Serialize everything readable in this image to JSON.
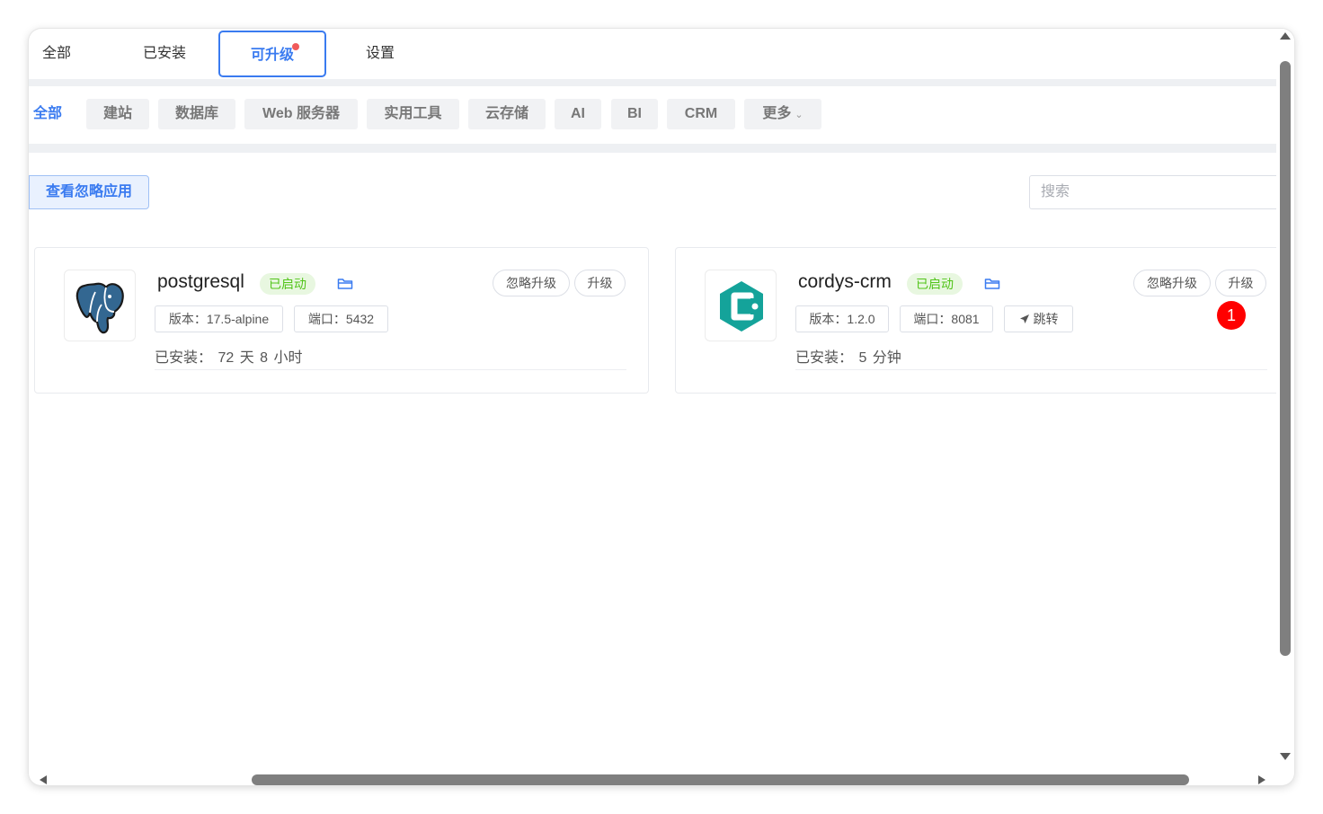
{
  "tabs": [
    {
      "label": "全部"
    },
    {
      "label": "已安装"
    },
    {
      "label": "可升级",
      "active": true,
      "has_dot": true
    },
    {
      "label": "设置"
    }
  ],
  "categories": [
    {
      "label": "全部",
      "active": true
    },
    {
      "label": "建站"
    },
    {
      "label": "数据库"
    },
    {
      "label": "Web 服务器"
    },
    {
      "label": "实用工具"
    },
    {
      "label": "云存储"
    },
    {
      "label": "AI"
    },
    {
      "label": "BI"
    },
    {
      "label": "CRM"
    },
    {
      "label": "更多"
    }
  ],
  "toolbar": {
    "ignored_apps_label": "查看忽略应用",
    "search_placeholder": "搜索"
  },
  "apps": [
    {
      "name": "postgresql",
      "status": "已启动",
      "icon": "postgresql-elephant-logo",
      "version": "版本：17.5-alpine",
      "port": "端口：5432",
      "installed": "已安装：   72 天 8 小时",
      "ignore_label": "忽略升级",
      "upgrade_label": "升级"
    },
    {
      "name": "cordys-crm",
      "status": "已启动",
      "icon": "cordys-crm-logo",
      "version": "版本：1.2.0",
      "port": "端口：8081",
      "jump_label": "跳转",
      "installed": "已安装：   5 分钟",
      "ignore_label": "忽略升级",
      "upgrade_label": "升级",
      "badge": "1"
    }
  ],
  "colors": {
    "accent": "#3a7bf0",
    "status_green": "#52c41a",
    "badge_red": "#ff0000"
  }
}
